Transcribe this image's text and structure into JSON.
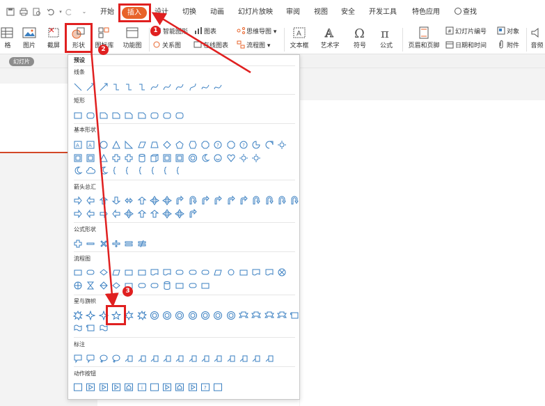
{
  "menu": {
    "tabs": [
      "开始",
      "插入",
      "设计",
      "切换",
      "动画",
      "幻灯片放映",
      "审阅",
      "视图",
      "安全",
      "开发工具",
      "特色应用"
    ],
    "search_label": "查找"
  },
  "ribbon": {
    "table_label": "格",
    "picture_label": "图片",
    "screenshot_label": "截屏",
    "shape_label": "形状",
    "gallery_label": "图标库",
    "function_label": "功能图",
    "smartart_label": "智能图形",
    "chart_label": "图表",
    "mindmap_label": "思维导图",
    "relation_label": "关系图",
    "onlinechart_label": "在线图表",
    "flowchart_label": "流程图",
    "textbox_label": "文本框",
    "wordart_label": "艺术字",
    "symbol_label": "符号",
    "formula_label": "公式",
    "headerfooter_label": "页眉和页脚",
    "slideno_label": "幻灯片编号",
    "object_label": "对象",
    "datetime_label": "日期和时间",
    "attachment_label": "附件",
    "audio_label": "音频"
  },
  "slides_tab": "幻灯片",
  "panel": {
    "preset": "预设",
    "categories": {
      "lines": "线条",
      "rects": "矩形",
      "basic": "基本形状",
      "arrows": "箭头总汇",
      "formula": "公式形状",
      "flowchart": "流程图",
      "stars": "星与旗帜",
      "callouts": "标注",
      "actions": "动作按钮"
    }
  },
  "badges": [
    "1",
    "2",
    "3"
  ],
  "colors": {
    "accent": "#e8632a",
    "annotation": "#e02020",
    "shape_stroke": "#3a7fc1"
  }
}
